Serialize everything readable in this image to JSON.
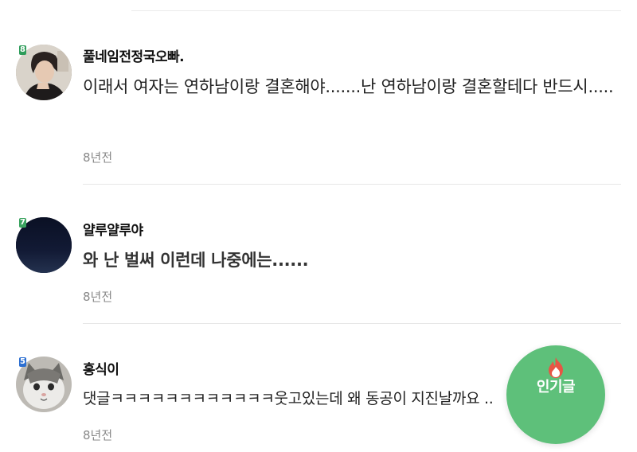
{
  "comments": [
    {
      "username": "풀네임전정국오빠.",
      "level": "8",
      "level_color": "#2e9c5a",
      "text": "이래서 여자는 연하남이랑 결혼해야.......난 연하남이랑 결혼할테다 반드시.....",
      "time": "8년전",
      "avatar_icon": "person-photo"
    },
    {
      "username": "얄루얄루야",
      "level": "7",
      "level_color": "#3aa35f",
      "text": "와 난 벌써 이런데 나중에는......",
      "time": "8년전",
      "avatar_icon": "dark-night-sky"
    },
    {
      "username": "홍식이",
      "level": "5",
      "level_color": "#2c6fd1",
      "text": "댓글ㅋㅋㅋㅋㅋㅋㅋㅋㅋㅋㅋㅋ웃고있는데 왜 동공이 지진날까요 ..",
      "time": "8년전",
      "avatar_icon": "cat-photo"
    }
  ],
  "fab": {
    "label": "인기글",
    "icon": "fire-icon",
    "color": "#5ec07a"
  }
}
